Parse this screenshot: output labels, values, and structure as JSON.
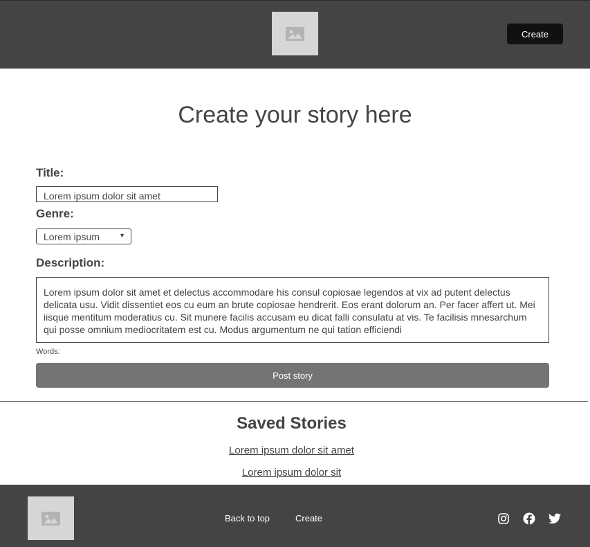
{
  "header": {
    "logo_icon": "image-placeholder-icon",
    "create_label": "Create"
  },
  "main": {
    "page_title": "Create your story here",
    "form": {
      "title_label": "Title:",
      "title_value": "Lorem ipsum dolor sit amet",
      "genre_label": "Genre:",
      "genre_value": "Lorem ipsum",
      "description_label": "Description:",
      "description_value": "Lorem ipsum dolor sit amet et delectus accommodare his consul copiosae legendos at vix ad putent delectus delicata usu. Vidit dissentiet eos cu eum an brute copiosae hendrerit. Eos erant dolorum an. Per facer affert ut. Mei iisque mentitum moderatius cu. Sit munere facilis accusam eu dicat falli consulatu at vis. Te facilisis mnesarchum qui posse omnium mediocritatem est cu. Modus argumentum ne qui tation efficiendi",
      "words_label": "Words:",
      "post_label": "Post story"
    },
    "saved": {
      "title": "Saved Stories",
      "items": [
        {
          "label": "Lorem ipsum dolor sit amet"
        },
        {
          "label": "Lorem ipsum dolor sit"
        }
      ]
    }
  },
  "footer": {
    "logo_icon": "image-placeholder-icon",
    "back_to_top_label": "Back to top",
    "create_label": "Create",
    "social_icons": [
      "instagram-icon",
      "facebook-icon",
      "twitter-icon"
    ]
  },
  "colors": {
    "header_bg": "#444444",
    "text": "#444444",
    "button_dark": "#111111",
    "button_post": "#747474",
    "placeholder": "#d6d6d6"
  }
}
